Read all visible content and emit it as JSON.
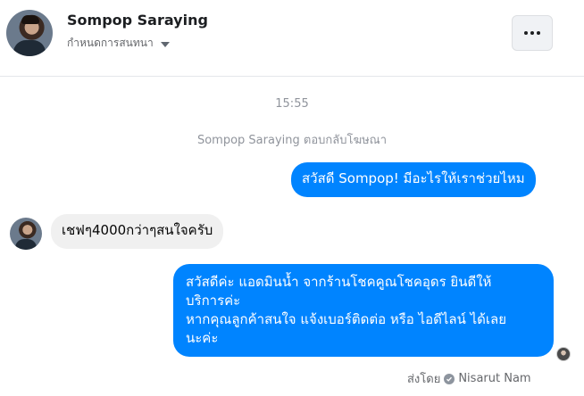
{
  "header": {
    "name": "Sompop Saraying",
    "subtitle": "กำหนดการสนทนา"
  },
  "conversation": {
    "timestamp": "15:55",
    "notice": "Sompop Saraying ตอบกลับโฆษณา",
    "messages": [
      {
        "direction": "outgoing",
        "lines": [
          "สวัสดี Sompop! มีอะไรให้เราช่วยไหม"
        ]
      },
      {
        "direction": "incoming",
        "lines": [
          "เชฟๆ4000กว่าๆสนใจครับ"
        ]
      },
      {
        "direction": "outgoing",
        "lines": [
          "สวัสดีค่ะ แอดมินน้ำ จากร้านโชคคูณโชคอุดร ยินดีให้",
          "บริการค่ะ",
          "หากคุณลูกค้าสนใจ แจ้งเบอร์ติดต่อ หรือ ไอดีไลน์ ได้เลย",
          "นะค่ะ"
        ]
      }
    ],
    "sent_by_label": "ส่งโดย",
    "sent_by_name": "Nisarut Nam"
  },
  "colors": {
    "outgoing_bubble": "#0084ff",
    "incoming_bubble": "#f0f0f0",
    "muted_text": "#90949c"
  }
}
